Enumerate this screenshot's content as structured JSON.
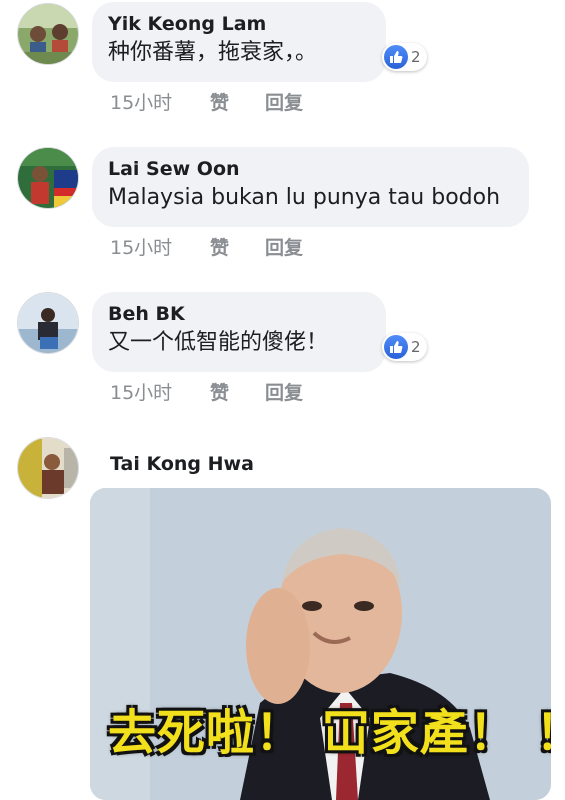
{
  "comments": [
    {
      "name": "Yik Keong Lam",
      "text": "种你番薯，拖衰家，。",
      "reactions": "2",
      "time": "15小时",
      "like_label": "赞",
      "reply_label": "回复"
    },
    {
      "name": "Lai Sew Oon",
      "text": "Malaysia bukan lu punya tau bodoh",
      "time": "15小时",
      "like_label": "赞",
      "reply_label": "回复"
    },
    {
      "name": "Beh BK",
      "text": "又一个低智能的傻佬！",
      "reactions": "2",
      "time": "15小时",
      "like_label": "赞",
      "reply_label": "回复"
    },
    {
      "name": "Tai Kong Hwa",
      "image_caption": "去死啦！ 冚家產！ ！"
    }
  ],
  "colors": {
    "bubble": "#f0f2f5",
    "like_blue": "#3b73e8",
    "meta_gray": "#8a8d91",
    "caption_yellow": "#f3e01c"
  },
  "icons": [
    "thumbs-up-icon"
  ]
}
